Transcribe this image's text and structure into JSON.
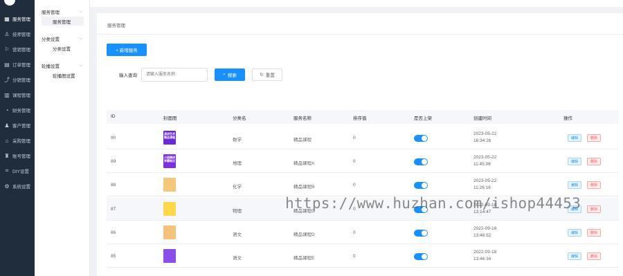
{
  "sidebar": {
    "items": [
      {
        "label": "服务管理",
        "icon": "grid-icon",
        "active": true
      },
      {
        "label": "技师管理",
        "icon": "user-icon"
      },
      {
        "label": "营销管理",
        "icon": "tag-icon"
      },
      {
        "label": "订单管理",
        "icon": "order-icon"
      },
      {
        "label": "分销管理",
        "icon": "share-icon"
      },
      {
        "label": "课程管理",
        "icon": "book-icon"
      },
      {
        "label": "财务管理",
        "icon": "money-icon"
      },
      {
        "label": "客户管理",
        "icon": "customers-icon"
      },
      {
        "label": "采购管理",
        "icon": "cart-icon"
      },
      {
        "label": "账号管理",
        "icon": "account-icon"
      },
      {
        "label": "DIY设置",
        "icon": "diy-icon"
      },
      {
        "label": "系统设置",
        "icon": "gear-icon"
      }
    ]
  },
  "submenu": {
    "groups": [
      {
        "label": "服务管理",
        "items": [
          "服务管理"
        ]
      },
      {
        "label": "分类设置",
        "items": [
          "分类设置"
        ]
      },
      {
        "label": "轮播设置",
        "items": [
          "轮播图设置"
        ]
      }
    ]
  },
  "page": {
    "breadcrumb": "服务管理",
    "add_button": "+ 新增服务",
    "search_label": "输入查询",
    "search_placeholder": "请输入服务名称",
    "search_button": "搜索",
    "reset_button": "重置"
  },
  "table": {
    "headers": [
      "ID",
      "封面图",
      "分类名",
      "服务名称",
      "排序值",
      "是否上架",
      "创建时间",
      "操作"
    ],
    "edit_label": "编辑",
    "delete_label": "删除",
    "rows": [
      {
        "id": "90",
        "thumb_text": "演讲艺术 精品课程",
        "thumb_color": "#6a2bd6",
        "category": "数学",
        "name": "精品课程",
        "sort": "0",
        "date": "2023-05-22",
        "time": "16:34:26"
      },
      {
        "id": "89",
        "thumb_text": "小班精讲 学霸笔记",
        "thumb_color": "#7b2fe0",
        "category": "地理",
        "name": "精品课程A",
        "sort": "0",
        "date": "2023-05-22",
        "time": "11:45:06"
      },
      {
        "id": "88",
        "thumb_text": "",
        "thumb_color": "#f4c77a",
        "category": "化学",
        "name": "精品课程B",
        "sort": "0",
        "date": "2023-05-22",
        "time": "11:26:16"
      },
      {
        "id": "87",
        "thumb_text": "",
        "thumb_color": "#ffd84a",
        "category": "物理",
        "name": "精品课程C",
        "sort": "0",
        "date": "2022-09-18",
        "time": "13:14:47"
      },
      {
        "id": "86",
        "thumb_text": "",
        "thumb_color": "#f3c27b",
        "category": "语文",
        "name": "精品课程D",
        "sort": "0",
        "date": "2022-09-18",
        "time": "13:46:52"
      },
      {
        "id": "85",
        "thumb_text": "",
        "thumb_color": "#8a4fe8",
        "category": "语文",
        "name": "精品课程E",
        "sort": "0",
        "date": "2022-09-18",
        "time": "13:46:34"
      }
    ]
  },
  "watermark": "https://www.huzhan.com/ishop44453",
  "colors": {
    "primary": "#1890ff",
    "sidebar_bg": "#1f2d3d",
    "danger": "#ff4d4f"
  }
}
